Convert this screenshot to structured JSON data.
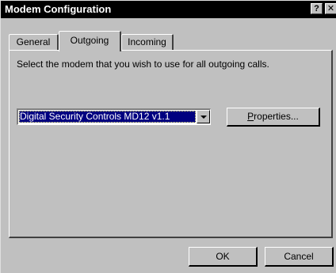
{
  "window": {
    "title": "Modem Configuration",
    "help_button": "?",
    "close_button": "✕"
  },
  "tabs": [
    {
      "label": "General",
      "active": false
    },
    {
      "label": "Outgoing",
      "active": true
    },
    {
      "label": "Incoming",
      "active": false
    }
  ],
  "outgoing": {
    "instruction": "Select the modem that you wish to use for all outgoing calls.",
    "modem_select": {
      "value": "Digital Security Controls MD12 v1.1"
    },
    "properties_button": {
      "mnemonic": "P",
      "rest": "roperties..."
    }
  },
  "footer": {
    "ok_label": "OK",
    "cancel_label": "Cancel"
  },
  "colors": {
    "titlebar": "#000000",
    "face": "#c0c0c0",
    "selection": "#000080"
  }
}
